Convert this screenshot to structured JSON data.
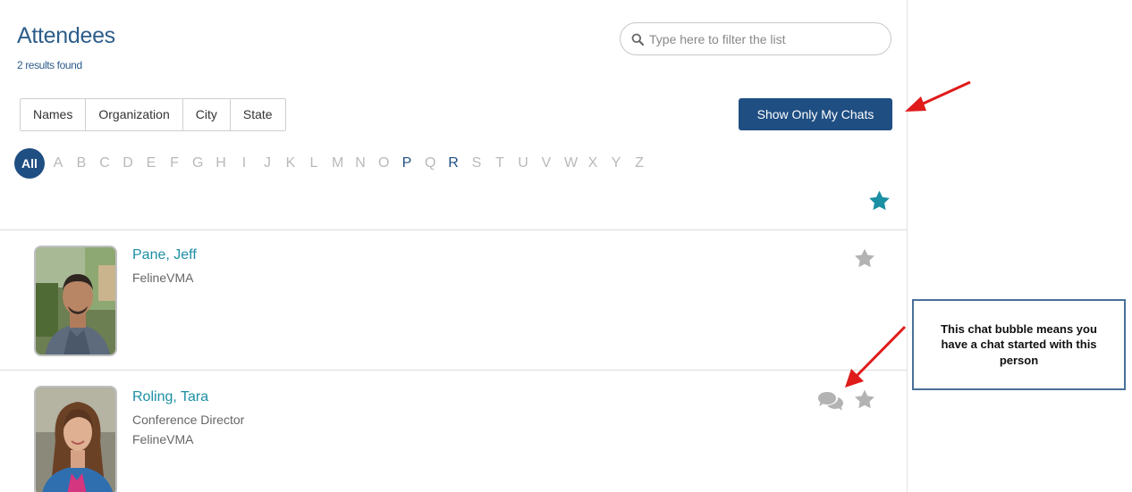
{
  "header": {
    "title": "Attendees",
    "results": "2 results found"
  },
  "search": {
    "placeholder": "Type here to filter the list"
  },
  "filters": [
    "Names",
    "Organization",
    "City",
    "State"
  ],
  "show_chats_label": "Show Only My Chats",
  "alphabet": {
    "all_label": "All",
    "letters": [
      "A",
      "B",
      "C",
      "D",
      "E",
      "F",
      "G",
      "H",
      "I",
      "J",
      "K",
      "L",
      "M",
      "N",
      "O",
      "P",
      "Q",
      "R",
      "S",
      "T",
      "U",
      "V",
      "W",
      "X",
      "Y",
      "Z"
    ],
    "active_letters": [
      "P",
      "R"
    ]
  },
  "attendees": [
    {
      "name": "Pane, Jeff",
      "lines": [
        "FelineVMA"
      ],
      "has_chat": false
    },
    {
      "name": "Roling, Tara",
      "lines": [
        "Conference Director",
        "FelineVMA"
      ],
      "has_chat": true
    }
  ],
  "callout": {
    "text": "This chat bubble means you have a chat started with this person"
  },
  "colors": {
    "accent": "#1f4e82",
    "link": "#1b8fa3",
    "favorite_star": "#1b8fa3",
    "inactive_star": "#b3b3b3",
    "annotation_arrow": "#e01b1b"
  },
  "icons": {
    "search": "search-icon",
    "favorite_filter": "star-icon",
    "favorite_toggle": "star-icon",
    "chat": "chat-bubble-icon"
  }
}
